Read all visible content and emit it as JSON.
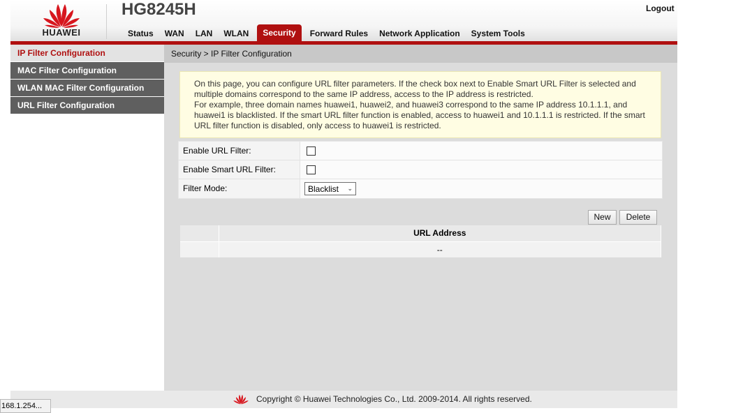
{
  "header": {
    "brand": "HUAWEI",
    "model": "HG8245H",
    "logout_label": "Logout",
    "accent_color": "#b01010"
  },
  "nav": {
    "items": [
      {
        "label": "Status"
      },
      {
        "label": "WAN"
      },
      {
        "label": "LAN"
      },
      {
        "label": "WLAN"
      },
      {
        "label": "Security",
        "active": true
      },
      {
        "label": "Forward Rules"
      },
      {
        "label": "Network Application"
      },
      {
        "label": "System Tools"
      }
    ]
  },
  "sidebar": {
    "items": [
      {
        "label": "IP Filter Configuration",
        "active": true
      },
      {
        "label": "MAC Filter Configuration"
      },
      {
        "label": "WLAN MAC Filter Configuration"
      },
      {
        "label": "URL Filter Configuration"
      }
    ]
  },
  "main": {
    "breadcrumb": "Security > IP Filter Configuration",
    "notice_line1": "On this page, you can configure URL filter parameters. If the check box next to Enable Smart URL Filter is selected and multiple domains correspond to the same IP address, access to the IP address is restricted.",
    "notice_line2": "For example, three domain names huawei1, huawei2, and huawei3 correspond to the same IP address 10.1.1.1, and huawei1 is blacklisted. If the smart URL filter function is enabled, access to huawei1 and 10.1.1.1 is restricted. If the smart URL filter function is disabled, only access to huawei1 is restricted.",
    "form": {
      "enable_url_filter_label": "Enable URL Filter:",
      "enable_url_filter_checked": false,
      "enable_smart_url_filter_label": "Enable Smart URL Filter:",
      "enable_smart_url_filter_checked": false,
      "filter_mode_label": "Filter Mode:",
      "filter_mode_value": "Blacklist"
    },
    "buttons": {
      "new_label": "New",
      "delete_label": "Delete"
    },
    "table": {
      "columns": [
        "",
        "URL Address"
      ],
      "rows": [
        [
          "",
          "--"
        ]
      ]
    }
  },
  "footer": {
    "copyright": "Copyright © Huawei Technologies Co., Ltd. 2009-2014. All rights reserved."
  },
  "status_bar": {
    "url_text": "168.1.254..."
  }
}
